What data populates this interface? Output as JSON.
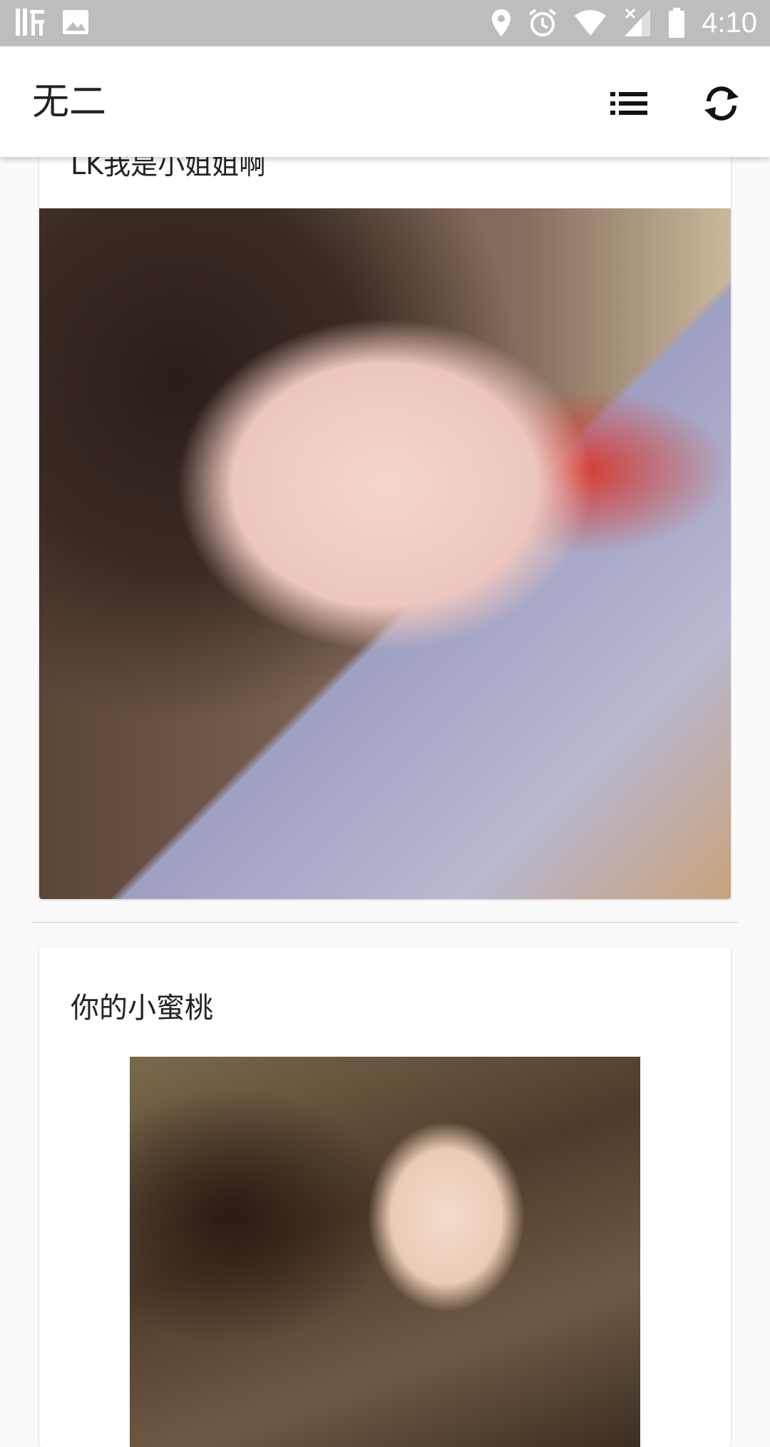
{
  "status_bar": {
    "time": "4:10",
    "left_icons": [
      "listen-app-icon",
      "image-icon"
    ],
    "right_icons": [
      "location-icon",
      "alarm-icon",
      "wifi-icon",
      "signal-icon",
      "battery-icon"
    ]
  },
  "app_bar": {
    "title": "无二",
    "actions": [
      "list-icon",
      "refresh-icon"
    ]
  },
  "feed": [
    {
      "title": "LK我是小姐姐啊",
      "image": "selfie-photo"
    },
    {
      "title": "你的小蜜桃",
      "image": "portrait-photo"
    }
  ],
  "colors": {
    "status_bar": "#bdbdbd",
    "app_bar": "#ffffff",
    "background": "#fafafa"
  }
}
